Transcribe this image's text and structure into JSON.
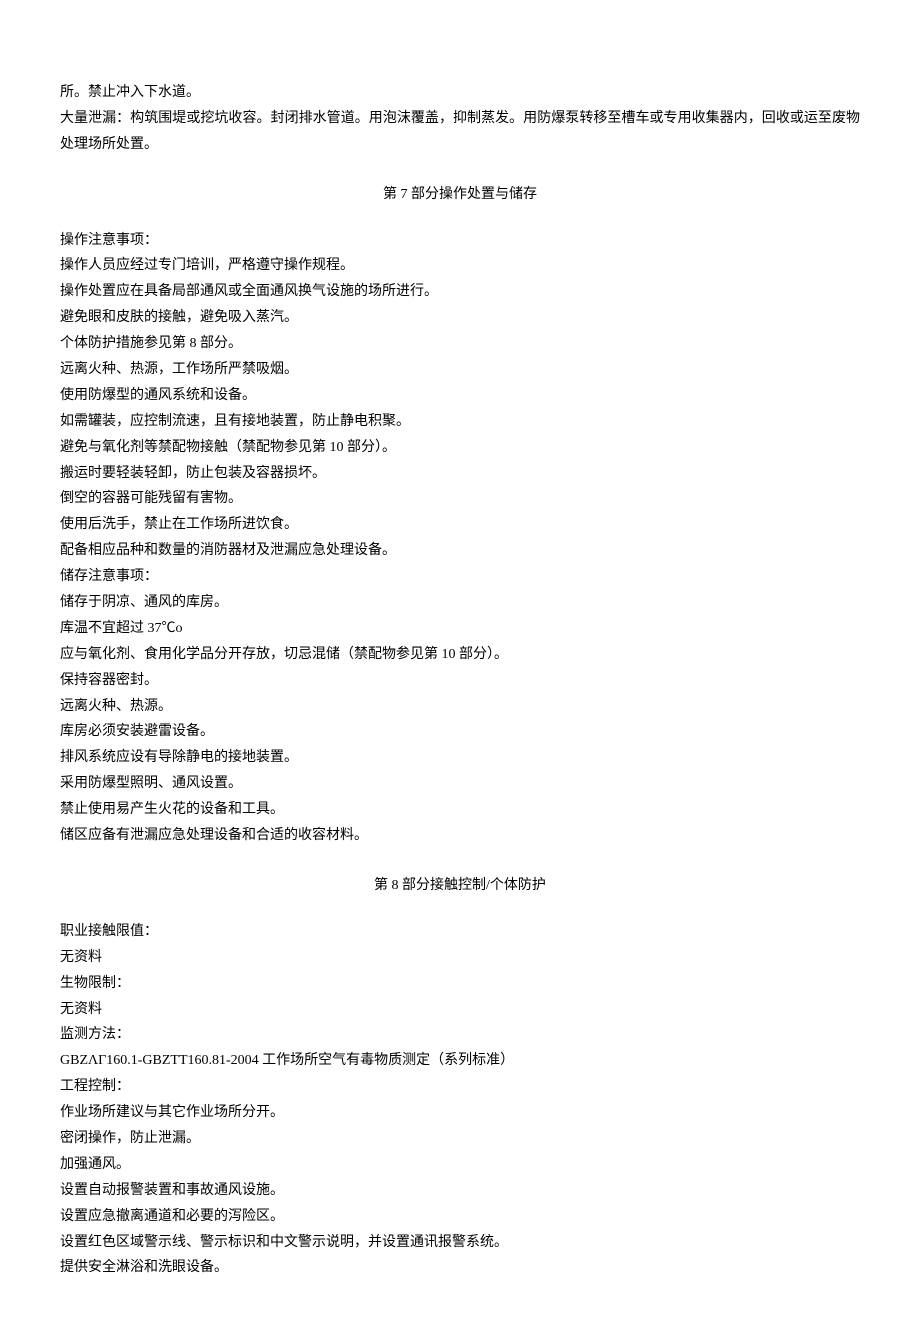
{
  "intro": {
    "p1": "所。禁止冲入下水道。",
    "p2": "大量泄漏：构筑围堤或挖坑收容。封闭排水管道。用泡沫覆盖，抑制蒸发。用防爆泵转移至槽车或专用收集器内，回收或运至废物处理场所处置。"
  },
  "section7": {
    "title": "第 7 部分操作处置与储存",
    "lines": [
      "操作注意事项：",
      "操作人员应经过专门培训，严格遵守操作规程。",
      "操作处置应在具备局部通风或全面通风换气设施的场所进行。",
      "避免眼和皮肤的接触，避免吸入蒸汽。",
      "个体防护措施参见第 8 部分。",
      "远离火种、热源，工作场所严禁吸烟。",
      "使用防爆型的通风系统和设备。",
      "如需罐装，应控制流速，且有接地装置，防止静电积聚。",
      "避免与氧化剂等禁配物接触（禁配物参见第 10 部分）。",
      "搬运时要轻装轻卸，防止包装及容器损坏。",
      "倒空的容器可能残留有害物。",
      "使用后洗手，禁止在工作场所进饮食。",
      "配备相应品种和数量的消防器材及泄漏应急处理设备。",
      "储存注意事项：",
      "储存于阴凉、通风的库房。",
      "库温不宜超过 37℃o",
      "应与氧化剂、食用化学品分开存放，切忌混储（禁配物参见第 10 部分）。",
      "保持容器密封。",
      "远离火种、热源。",
      "库房必须安装避雷设备。",
      "排风系统应设有导除静电的接地装置。",
      "采用防爆型照明、通风设置。",
      "禁止使用易产生火花的设备和工具。",
      "储区应备有泄漏应急处理设备和合适的收容材料。"
    ]
  },
  "section8": {
    "title": "第 8 部分接触控制/个体防护",
    "lines": [
      "职业接触限值：",
      "无资料",
      "生物限制：",
      "无资料",
      "监测方法：",
      "GBZΛΓ160.1-GBZTT160.81-2004 工作场所空气有毒物质测定（系列标准）",
      "工程控制：",
      "作业场所建议与其它作业场所分开。",
      "密闭操作，防止泄漏。",
      "加强通风。",
      "设置自动报警装置和事故通风设施。",
      "设置应急撤离通道和必要的泻险区。",
      "设置红色区域警示线、警示标识和中文警示说明，并设置通讯报警系统。",
      "提供安全淋浴和洗眼设备。"
    ]
  }
}
